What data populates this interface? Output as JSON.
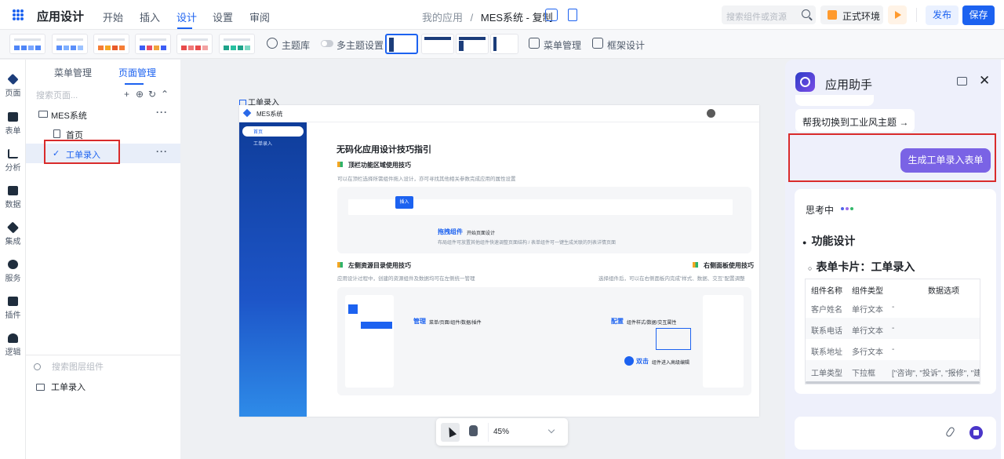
{
  "header": {
    "app_title": "应用设计",
    "menus": [
      "开始",
      "插入",
      "设计",
      "设置",
      "审阅"
    ],
    "active_menu": "设计",
    "breadcrumb_parent": "我的应用",
    "breadcrumb_sep": "/",
    "breadcrumb_current": "MES系统 - 复制",
    "search_placeholder": "搜索组件或资源",
    "env_label": "正式环境",
    "publish_label": "发布",
    "save_label": "保存",
    "accent_color": "#1c62f0"
  },
  "theme_toolbar": {
    "theme_lib": "主题库",
    "multi_theme": "多主题设置",
    "menu_manage": "菜单管理",
    "frame_design": "框架设计",
    "swatch_colors": [
      [
        "#4f86f7",
        "#4f86f7",
        "#7aa6ff",
        "#4f86f7"
      ],
      [
        "#5b8ff9",
        "#7fb0ff",
        "#5b8ff9",
        "#9cc2ff"
      ],
      [
        "#f57d36",
        "#f5a623",
        "#e85a2a",
        "#f57d36"
      ],
      [
        "#3c5df5",
        "#e84b67",
        "#f0a23c",
        "#3c5df5"
      ],
      [
        "#e84b4b",
        "#f07878",
        "#e84b4b",
        "#f3a2a2"
      ],
      [
        "#1fa38a",
        "#27c0a0",
        "#1fa38a",
        "#7dd8c3"
      ]
    ]
  },
  "rail": {
    "items": [
      "页面",
      "表单",
      "分析",
      "数据",
      "集成",
      "服务",
      "插件",
      "逻辑"
    ]
  },
  "sidebar": {
    "tabs": [
      "菜单管理",
      "页面管理"
    ],
    "active_tab": "页面管理",
    "search_placeholder": "搜索页面...",
    "actions": [
      "+",
      "⊕",
      "↻",
      "⌃"
    ],
    "tree": {
      "root": "MES系统",
      "children": [
        "首页",
        "工单录入"
      ],
      "selected": "工单录入",
      "more": "···"
    },
    "layer_search_placeholder": "搜索图层组件",
    "layer_item": "工单录入"
  },
  "canvas": {
    "frame_label": "工单录入",
    "preview": {
      "app_name": "MES系统",
      "nav": [
        "首页",
        "工单录入"
      ],
      "guide_title": "无码化应用设计技巧指引",
      "sec1_title": "顶栏功能区域使用技巧",
      "sec1_desc": "可以在顶栏选择所需组件拖入设计，亦可寻找其他相关参数完成应用的属性设置",
      "insert_tag": "插入",
      "drag_label": "拖拽组件",
      "drag_sub": "开始页面设计",
      "drag_desc": "布局组件可放置其他组件快速调整页面结构 / 表单组件可一键生成关联的列表详情页面",
      "sec2_title": "左侧资源目录使用技巧",
      "sec2_desc": "应用设计过程中，创建的资源组件及数据均可在左侧统一管理",
      "sec3_title": "右侧面板使用技巧",
      "sec3_desc": "选择组件后，可以在右侧面板内完成\"样式、数据、交互\"配置调整",
      "manage_label": "管理",
      "manage_sub": "菜单/页面/组件/数据/插件",
      "config_label": "配置",
      "config_sub": "组件样式/数据/交互属性",
      "dbl_label": "双击",
      "dbl_sub": "组件进入高级编辑"
    },
    "zoom": "45%"
  },
  "assistant": {
    "title": "应用助手",
    "suggestion": "帮我切换到工业风主题 →",
    "generate_button": "生成工单录入表单",
    "thinking": "思考中",
    "function_title": "功能设计",
    "card_title": "表单卡片：工单录入",
    "table": {
      "headers": [
        "组件名称",
        "组件类型",
        "数据选项"
      ],
      "rows": [
        [
          "客户姓名",
          "单行文本",
          "-"
        ],
        [
          "联系电话",
          "单行文本",
          "-"
        ],
        [
          "联系地址",
          "多行文本",
          "-"
        ],
        [
          "工单类型",
          "下拉框",
          "[\"咨询\", \"投诉\", \"报修\", \"建"
        ]
      ]
    },
    "accent_color": "#7a63e5"
  }
}
